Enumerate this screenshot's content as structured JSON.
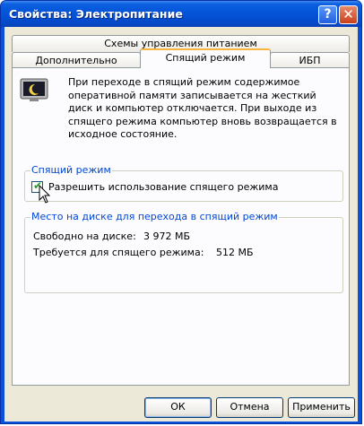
{
  "window": {
    "title": "Свойства: Электропитание",
    "help_glyph": "?",
    "close_glyph": "✕"
  },
  "tabs": {
    "row1": [
      "Схемы управления питанием"
    ],
    "row2": [
      "Дополнительно",
      "Спящий режим",
      "ИБП"
    ],
    "active": "Спящий режим"
  },
  "description": "При переходе в спящий режим содержимое оперативной памяти записывается на жесткий диск и компьютер отключается. При выходе из спящего режима компьютер вновь возвращается в исходное состояние.",
  "hibernate_group": {
    "legend": "Спящий режим",
    "checkbox_label": "Разрешить использование спящего режима",
    "checked": true
  },
  "disk_group": {
    "legend": "Место на диске для перехода в спящий режим",
    "free_label": "Свободно на диске:",
    "free_value": "3 972 МБ",
    "required_label": "Требуется для спящего режима:",
    "required_value": "512 МБ"
  },
  "buttons": {
    "ok": "ОК",
    "cancel": "Отмена",
    "apply": "Применить"
  },
  "colors": {
    "title_bar": "#0553d8",
    "accent_tab": "#f8b640",
    "group_legend": "#0046d5"
  },
  "icons": [
    "hibernate-monitor-icon",
    "help-icon",
    "close-icon",
    "mouse-pointer-icon"
  ]
}
